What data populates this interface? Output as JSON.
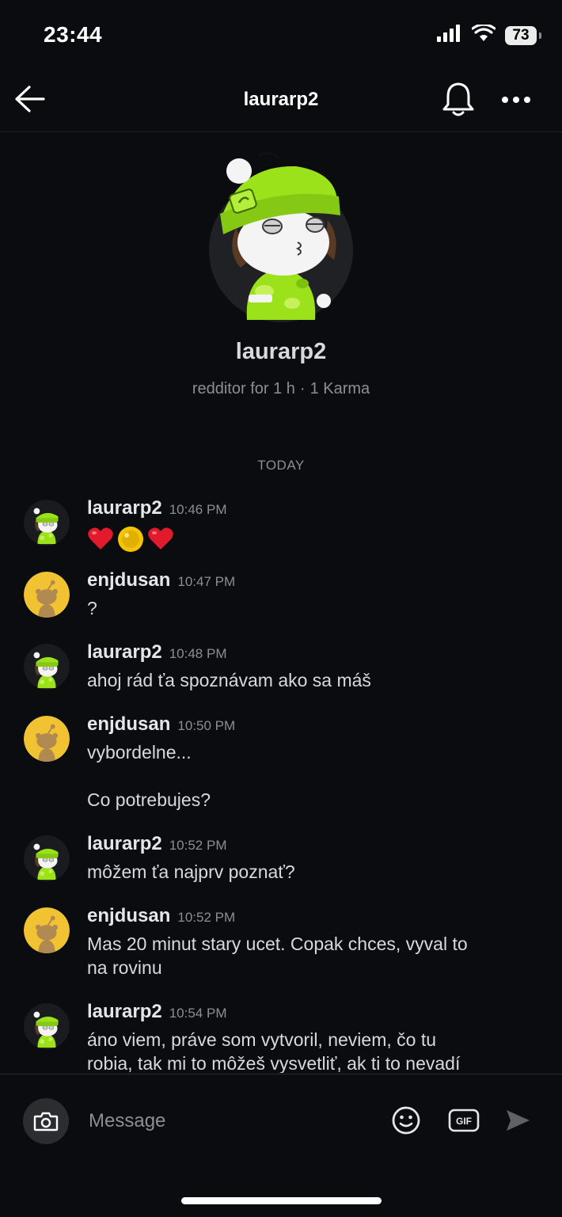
{
  "status": {
    "time": "23:44",
    "battery": "73"
  },
  "header": {
    "title": "laurarp2"
  },
  "profile": {
    "name": "laurarp2",
    "age": "redditor for 1 h",
    "separator": "·",
    "karma": "1 Karma"
  },
  "divider": "TODAY",
  "messages": [
    {
      "user": "laurarp2",
      "time": "10:46 PM",
      "emojis": [
        "heart",
        "coin",
        "heart"
      ]
    },
    {
      "user": "enjdusan",
      "time": "10:47 PM",
      "text": "?"
    },
    {
      "user": "laurarp2",
      "time": "10:48 PM",
      "text": "ahoj rád ťa spoznávam ako sa máš"
    },
    {
      "user": "enjdusan",
      "time": "10:50 PM",
      "text": "vybordelne...",
      "text2": "Co potrebujes?"
    },
    {
      "user": "laurarp2",
      "time": "10:52 PM",
      "text": "môžem ťa najprv poznať?"
    },
    {
      "user": "enjdusan",
      "time": "10:52 PM",
      "text": "Mas 20 minut stary ucet. Copak chces, vyval to",
      "text2": "na rovinu"
    },
    {
      "user": "laurarp2",
      "time": "10:54 PM",
      "text": "áno viem, práve som vytvoril, neviem, čo tu",
      "text2": "robia, tak mi to môžeš vysvetliť, ak ti to nevadí"
    }
  ],
  "composer": {
    "placeholder": "Message",
    "gif": "GIF"
  },
  "colors": {
    "background": "#0b0c0f",
    "lime": "#9be21a",
    "snoo_yellow": "#f1c232"
  }
}
